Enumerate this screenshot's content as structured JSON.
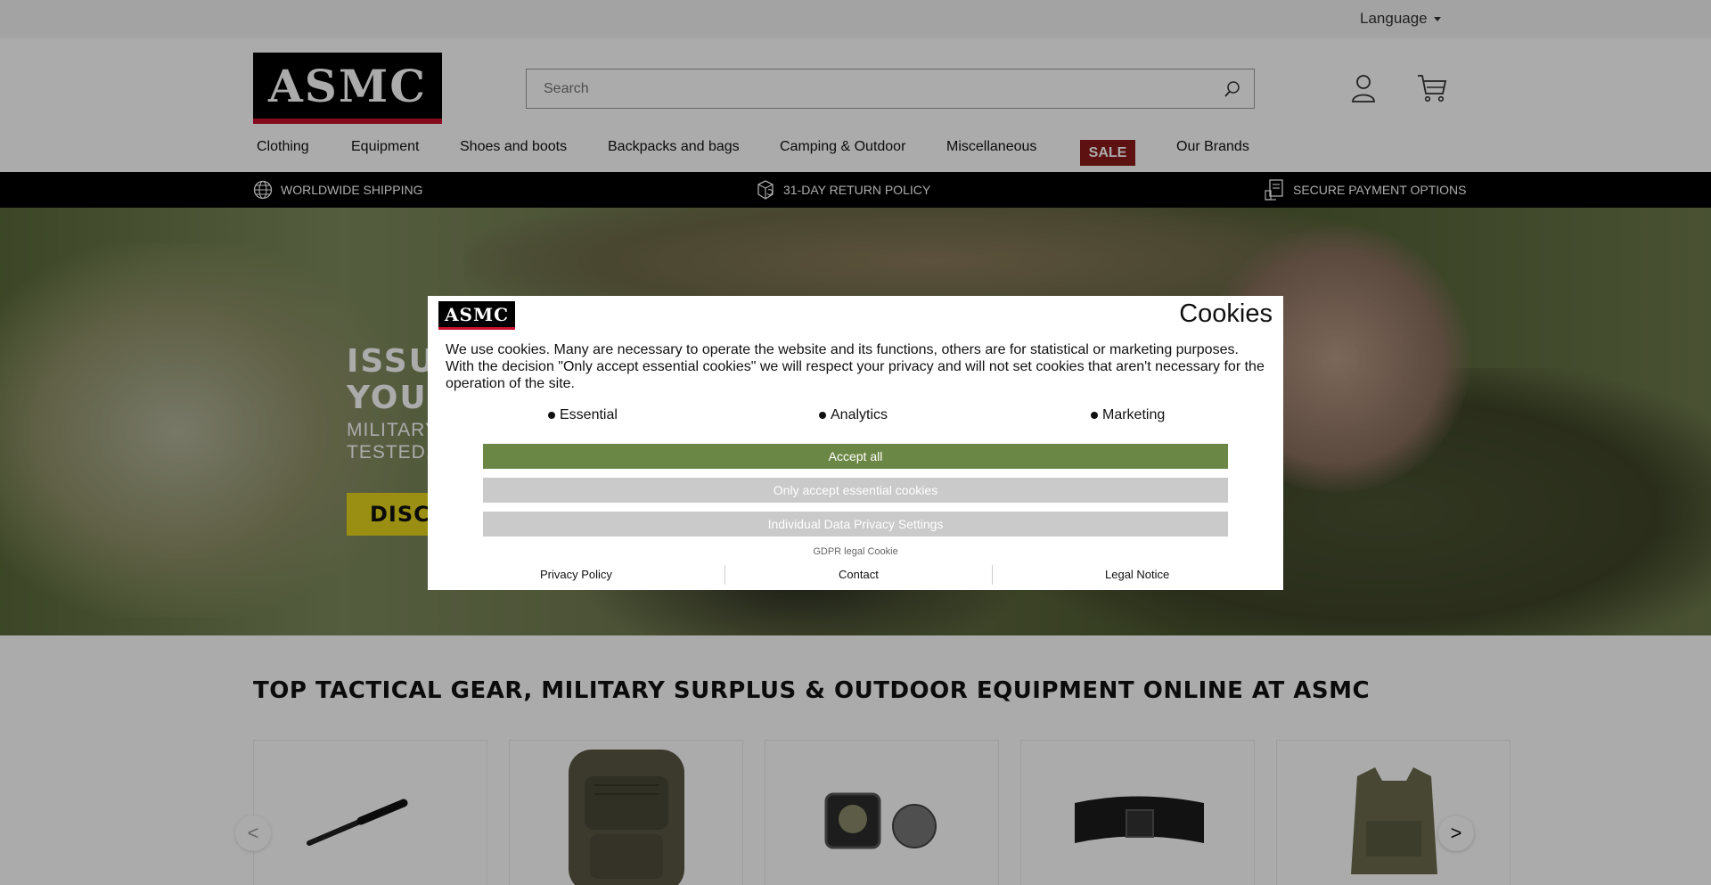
{
  "topbar": {
    "language_label": "Language"
  },
  "header": {
    "logo_text": "ASMC",
    "search_placeholder": "Search",
    "icons": [
      "search-icon",
      "user-icon",
      "cart-icon"
    ]
  },
  "nav": {
    "items": [
      {
        "label": "Clothing"
      },
      {
        "label": "Equipment"
      },
      {
        "label": "Shoes and boots"
      },
      {
        "label": "Backpacks and bags"
      },
      {
        "label": "Camping & Outdoor"
      },
      {
        "label": "Miscellaneous"
      },
      {
        "label": "SALE"
      },
      {
        "label": "Our Brands"
      }
    ]
  },
  "usp": {
    "items": [
      {
        "label": "WORLDWIDE SHIPPING",
        "icon": "globe-icon"
      },
      {
        "label": "31-DAY RETURN POLICY",
        "icon": "return-box-icon"
      },
      {
        "label": "SECURE PAYMENT OPTIONS",
        "icon": "receipt-icon"
      }
    ]
  },
  "hero": {
    "title_line1": "ISSU",
    "title_line2": "YOUR",
    "sub_line1": "MILITARY",
    "sub_line2": "TESTED, T",
    "button_label": "DISCO"
  },
  "section": {
    "title": "TOP TACTICAL GEAR, MILITARY SURPLUS & OUTDOOR EQUIPMENT ONLINE AT ASMC"
  },
  "carousel": {
    "prev": "<",
    "next": ">",
    "items": [
      "baton",
      "backpack",
      "patch",
      "belt",
      "vest"
    ]
  },
  "cookie": {
    "logo_text": "ASMC",
    "title": "Cookies",
    "text": "We use cookies. Many are necessary to operate the website and its functions, others are for statistical or marketing purposes. With the decision \"Only accept essential cookies\" we will respect your privacy and will not set cookies that aren't necessary for the operation of the site.",
    "categories": [
      {
        "label": "Essential"
      },
      {
        "label": "Analytics"
      },
      {
        "label": "Marketing"
      }
    ],
    "accept_all": "Accept all",
    "only_essential": "Only accept essential cookies",
    "individual": "Individual Data Privacy Settings",
    "gdpr": "GDPR legal Cookie",
    "links": [
      {
        "label": "Privacy Policy"
      },
      {
        "label": "Contact"
      },
      {
        "label": "Legal Notice"
      }
    ]
  },
  "colors": {
    "accept_green": "#6b8745",
    "sale_red": "#8b1a1a",
    "hero_button_yellow": "#e6d51c",
    "brand_red": "#c8102e"
  }
}
